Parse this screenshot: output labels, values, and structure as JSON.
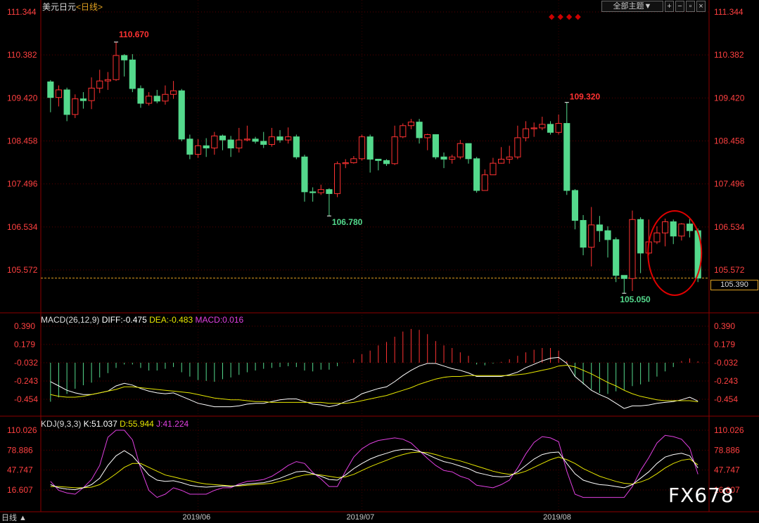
{
  "header": {
    "title": "美元日元",
    "period": "<日线>",
    "toolbar_main": "全部主题▼",
    "toolbar_icons": [
      "plus-icon",
      "minus-icon",
      "window-icon",
      "close-icon"
    ]
  },
  "price_axis": [
    "111.344",
    "110.382",
    "109.420",
    "108.458",
    "107.496",
    "106.534",
    "105.572"
  ],
  "current_price": "105.390",
  "annotations": {
    "high1": "110.670",
    "low1": "106.780",
    "high2": "109.320",
    "low2": "105.050"
  },
  "macd": {
    "label": "MACD(26,12,9)",
    "diff": "DIFF:-0.475",
    "dea": "DEA:-0.483",
    "macd": "MACD:0.016",
    "axis": [
      "0.390",
      "0.179",
      "-0.032",
      "-0.243",
      "-0.454"
    ]
  },
  "kdj": {
    "label": "KDJ(9,3,3)",
    "k": "K:51.037",
    "d": "D:55.944",
    "j": "J:41.224",
    "axis": [
      "110.026",
      "78.886",
      "47.747",
      "16.607"
    ]
  },
  "x_labels": [
    "2019/06",
    "2019/07",
    "2019/08"
  ],
  "footer_left": "日线 ▲",
  "watermark": "FX678",
  "diamonds": "◆◆◆◆",
  "colors": {
    "up": "#ff3232",
    "down": "#54d98c",
    "diff": "#ffffff",
    "dea": "#e6e600",
    "macd_label": "#e040e0",
    "k": "#ffffff",
    "d": "#e6e600",
    "j": "#e040e0",
    "grid": "#8b0000",
    "axis_text": "#ff4040",
    "highlight_circle": "#e00000"
  },
  "chart_data": {
    "type": "candlestick",
    "title": "美元日元<日线>",
    "x_ticks": [
      "2019/06",
      "2019/07",
      "2019/08"
    ],
    "price_range": [
      105.0,
      111.344
    ],
    "macd_range": [
      -0.55,
      0.39
    ],
    "kdj_range": [
      5,
      110.026
    ],
    "candles": [
      [
        109.78,
        109.43,
        109.82,
        109.1
      ],
      [
        109.43,
        109.6,
        109.7,
        109.23
      ],
      [
        109.6,
        109.05,
        109.65,
        108.9
      ],
      [
        109.05,
        109.4,
        109.5,
        108.97
      ],
      [
        109.4,
        109.36,
        109.55,
        109.18
      ],
      [
        109.36,
        109.64,
        109.88,
        109.17
      ],
      [
        109.64,
        109.8,
        110.05,
        109.53
      ],
      [
        109.8,
        109.83,
        110.0,
        109.6
      ],
      [
        109.83,
        110.37,
        110.67,
        109.8
      ],
      [
        110.37,
        110.27,
        110.4,
        109.9
      ],
      [
        110.27,
        109.63,
        110.4,
        109.55
      ],
      [
        109.63,
        109.3,
        109.7,
        109.2
      ],
      [
        109.3,
        109.46,
        109.55,
        109.25
      ],
      [
        109.46,
        109.35,
        109.6,
        109.3
      ],
      [
        109.35,
        109.5,
        109.7,
        109.27
      ],
      [
        109.5,
        109.58,
        109.8,
        109.4
      ],
      [
        109.58,
        108.5,
        109.62,
        108.45
      ],
      [
        108.5,
        108.16,
        108.6,
        108.05
      ],
      [
        108.16,
        108.35,
        108.5,
        108.08
      ],
      [
        108.35,
        108.3,
        108.52,
        108.1
      ],
      [
        108.3,
        108.57,
        108.66,
        108.15
      ],
      [
        108.57,
        108.48,
        108.6,
        108.25
      ],
      [
        108.48,
        108.3,
        108.57,
        108.1
      ],
      [
        108.3,
        108.48,
        108.75,
        108.2
      ],
      [
        108.48,
        108.5,
        108.8,
        108.45
      ],
      [
        108.5,
        108.45,
        108.55,
        108.4
      ],
      [
        108.45,
        108.38,
        108.66,
        108.3
      ],
      [
        108.38,
        108.55,
        108.75,
        108.33
      ],
      [
        108.55,
        108.48,
        108.7,
        108.42
      ],
      [
        108.48,
        108.55,
        108.76,
        108.4
      ],
      [
        108.55,
        108.1,
        108.6,
        108.05
      ],
      [
        108.1,
        107.32,
        108.15,
        107.1
      ],
      [
        107.32,
        107.3,
        107.42,
        107.1
      ],
      [
        107.3,
        107.37,
        107.48,
        107.25
      ],
      [
        107.37,
        107.28,
        107.4,
        106.78
      ],
      [
        107.28,
        107.95,
        108.0,
        107.2
      ],
      [
        107.95,
        107.97,
        108.05,
        107.85
      ],
      [
        107.97,
        108.06,
        108.12,
        107.95
      ],
      [
        108.06,
        108.55,
        108.6,
        108.02
      ],
      [
        108.55,
        108.05,
        108.6,
        107.75
      ],
      [
        108.05,
        108.02,
        108.05,
        107.8
      ],
      [
        108.02,
        107.95,
        108.05,
        107.9
      ],
      [
        107.95,
        108.55,
        108.8,
        107.92
      ],
      [
        108.55,
        108.8,
        108.85,
        108.52
      ],
      [
        108.8,
        108.88,
        108.95,
        108.72
      ],
      [
        108.88,
        108.53,
        108.95,
        108.4
      ],
      [
        108.53,
        108.6,
        108.62,
        108.25
      ],
      [
        108.6,
        108.1,
        108.6,
        108.05
      ],
      [
        108.1,
        108.05,
        108.2,
        107.85
      ],
      [
        108.05,
        108.1,
        108.15,
        107.95
      ],
      [
        108.1,
        108.4,
        108.48,
        108.05
      ],
      [
        108.4,
        108.06,
        108.4,
        107.95
      ],
      [
        108.06,
        107.35,
        108.1,
        107.3
      ],
      [
        107.35,
        107.7,
        107.82,
        107.35
      ],
      [
        107.7,
        107.96,
        108.08,
        107.75
      ],
      [
        107.96,
        108.05,
        108.32,
        107.95
      ],
      [
        108.05,
        108.1,
        108.35,
        107.95
      ],
      [
        108.1,
        108.53,
        108.8,
        108.05
      ],
      [
        108.53,
        108.73,
        108.9,
        108.45
      ],
      [
        108.73,
        108.75,
        108.87,
        108.55
      ],
      [
        108.75,
        108.83,
        109.0,
        108.7
      ],
      [
        108.83,
        108.65,
        108.9,
        108.6
      ],
      [
        108.65,
        108.85,
        109.05,
        108.6
      ],
      [
        108.85,
        107.35,
        109.32,
        107.25
      ],
      [
        107.35,
        106.68,
        107.38,
        106.48
      ],
      [
        106.68,
        106.08,
        106.8,
        105.9
      ],
      [
        106.08,
        106.58,
        106.98,
        105.65
      ],
      [
        106.58,
        106.45,
        106.78,
        106.2
      ],
      [
        106.45,
        106.25,
        106.55,
        105.85
      ],
      [
        106.25,
        105.45,
        106.3,
        105.3
      ],
      [
        105.45,
        105.38,
        105.42,
        105.05
      ],
      [
        105.38,
        106.7,
        106.9,
        105.1
      ],
      [
        106.7,
        105.95,
        106.75,
        105.5
      ],
      [
        105.95,
        106.2,
        106.7,
        105.9
      ],
      [
        106.2,
        106.4,
        106.55,
        106.15
      ],
      [
        106.4,
        106.65,
        106.72,
        106.1
      ],
      [
        106.65,
        106.33,
        106.7,
        106.15
      ],
      [
        106.33,
        106.6,
        106.62,
        106.23
      ],
      [
        106.6,
        106.45,
        106.72,
        106.3
      ],
      [
        106.45,
        105.39,
        106.5,
        105.3
      ]
    ],
    "macd_hist": [
      -0.45,
      -0.4,
      -0.36,
      -0.3,
      -0.26,
      -0.23,
      -0.17,
      -0.12,
      -0.06,
      -0.02,
      -0.02,
      -0.06,
      -0.09,
      -0.09,
      -0.07,
      -0.05,
      -0.11,
      -0.16,
      -0.2,
      -0.21,
      -0.22,
      -0.19,
      -0.17,
      -0.14,
      -0.11,
      -0.09,
      -0.07,
      -0.06,
      -0.05,
      -0.04,
      -0.05,
      -0.09,
      -0.1,
      -0.08,
      -0.08,
      -0.04,
      0.0,
      0.04,
      0.1,
      0.14,
      0.2,
      0.24,
      0.3,
      0.36,
      0.39,
      0.38,
      0.33,
      0.25,
      0.2,
      0.17,
      0.12,
      0.08,
      -0.02,
      -0.03,
      -0.01,
      0.01,
      0.04,
      0.08,
      0.12,
      0.15,
      0.17,
      0.17,
      0.14,
      0.02,
      -0.16,
      -0.25,
      -0.31,
      -0.35,
      -0.36,
      -0.33,
      -0.32,
      -0.27,
      -0.25,
      -0.22,
      -0.16,
      -0.1,
      -0.05,
      0.02,
      0.05,
      0.016
    ],
    "diff": [
      -0.25,
      -0.3,
      -0.35,
      -0.38,
      -0.4,
      -0.4,
      -0.38,
      -0.36,
      -0.3,
      -0.27,
      -0.29,
      -0.33,
      -0.36,
      -0.38,
      -0.39,
      -0.38,
      -0.42,
      -0.46,
      -0.5,
      -0.52,
      -0.54,
      -0.54,
      -0.54,
      -0.53,
      -0.51,
      -0.5,
      -0.5,
      -0.48,
      -0.46,
      -0.45,
      -0.45,
      -0.48,
      -0.51,
      -0.52,
      -0.54,
      -0.52,
      -0.48,
      -0.45,
      -0.39,
      -0.36,
      -0.33,
      -0.31,
      -0.25,
      -0.18,
      -0.12,
      -0.07,
      -0.04,
      -0.04,
      -0.07,
      -0.1,
      -0.12,
      -0.15,
      -0.19,
      -0.19,
      -0.19,
      -0.19,
      -0.17,
      -0.14,
      -0.09,
      -0.05,
      -0.01,
      0.02,
      0.03,
      -0.04,
      -0.19,
      -0.27,
      -0.35,
      -0.4,
      -0.44,
      -0.5,
      -0.56,
      -0.53,
      -0.53,
      -0.52,
      -0.5,
      -0.49,
      -0.48,
      -0.46,
      -0.43,
      -0.475
    ],
    "dea": [
      -0.4,
      -0.42,
      -0.43,
      -0.43,
      -0.42,
      -0.4,
      -0.38,
      -0.36,
      -0.34,
      -0.31,
      -0.31,
      -0.32,
      -0.33,
      -0.34,
      -0.35,
      -0.36,
      -0.37,
      -0.38,
      -0.4,
      -0.42,
      -0.44,
      -0.45,
      -0.46,
      -0.46,
      -0.47,
      -0.48,
      -0.48,
      -0.49,
      -0.49,
      -0.49,
      -0.49,
      -0.49,
      -0.49,
      -0.49,
      -0.5,
      -0.5,
      -0.5,
      -0.49,
      -0.47,
      -0.45,
      -0.43,
      -0.41,
      -0.38,
      -0.35,
      -0.32,
      -0.28,
      -0.25,
      -0.22,
      -0.2,
      -0.19,
      -0.19,
      -0.18,
      -0.18,
      -0.18,
      -0.18,
      -0.18,
      -0.18,
      -0.17,
      -0.16,
      -0.14,
      -0.12,
      -0.1,
      -0.07,
      -0.06,
      -0.08,
      -0.12,
      -0.16,
      -0.21,
      -0.26,
      -0.3,
      -0.35,
      -0.39,
      -0.42,
      -0.44,
      -0.46,
      -0.47,
      -0.47,
      -0.47,
      -0.47,
      -0.483
    ],
    "k": [
      25,
      20,
      18,
      17,
      20,
      25,
      35,
      55,
      70,
      78,
      70,
      55,
      40,
      32,
      30,
      31,
      28,
      24,
      22,
      21,
      22,
      23,
      22,
      24,
      26,
      27,
      28,
      31,
      35,
      40,
      45,
      46,
      42,
      38,
      33,
      32,
      40,
      50,
      58,
      65,
      70,
      74,
      78,
      80,
      80,
      77,
      72,
      66,
      61,
      58,
      54,
      50,
      44,
      41,
      38,
      37,
      38,
      45,
      55,
      65,
      72,
      75,
      76,
      58,
      42,
      32,
      28,
      25,
      24,
      22,
      20,
      25,
      35,
      45,
      58,
      68,
      72,
      74,
      70,
      51.037
    ],
    "d": [
      22,
      22,
      21,
      20,
      20,
      21,
      25,
      33,
      42,
      52,
      58,
      58,
      52,
      46,
      40,
      37,
      34,
      31,
      28,
      26,
      25,
      24,
      23,
      23,
      24,
      25,
      26,
      27,
      30,
      33,
      37,
      40,
      41,
      40,
      38,
      36,
      37,
      41,
      47,
      53,
      58,
      63,
      68,
      72,
      75,
      76,
      75,
      72,
      68,
      65,
      62,
      58,
      54,
      50,
      46,
      43,
      41,
      42,
      46,
      52,
      58,
      64,
      68,
      64,
      58,
      50,
      44,
      38,
      34,
      30,
      27,
      26,
      29,
      34,
      42,
      51,
      58,
      63,
      65,
      55.944
    ],
    "j": [
      30,
      16,
      12,
      10,
      20,
      33,
      55,
      99,
      110,
      110,
      95,
      50,
      16,
      5,
      10,
      20,
      16,
      10,
      10,
      10,
      16,
      20,
      20,
      26,
      30,
      31,
      33,
      38,
      46,
      55,
      61,
      58,
      44,
      34,
      22,
      22,
      46,
      68,
      81,
      89,
      94,
      96,
      98,
      96,
      90,
      78,
      66,
      55,
      47,
      45,
      38,
      34,
      24,
      22,
      20,
      25,
      32,
      51,
      73,
      91,
      100,
      98,
      92,
      46,
      10,
      5,
      5,
      5,
      5,
      5,
      5,
      22,
      47,
      67,
      90,
      102,
      100,
      96,
      82,
      41.224
    ]
  }
}
